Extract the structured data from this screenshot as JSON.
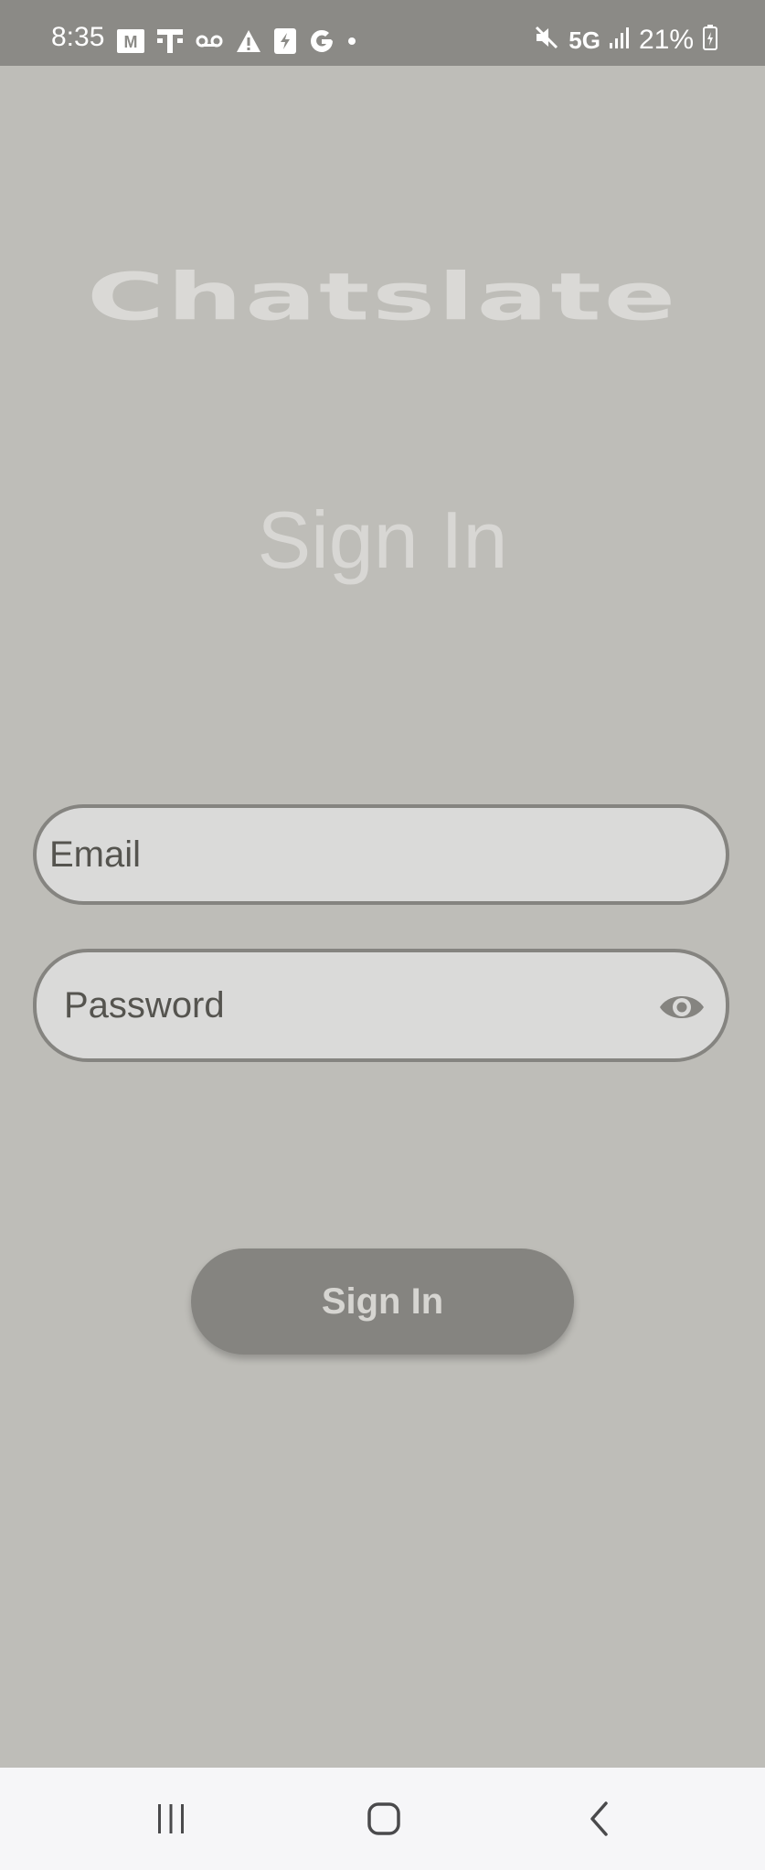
{
  "status_bar": {
    "time": "8:35",
    "left_icons": [
      "gmail-icon",
      "t-mobile-icon",
      "voicemail-icon",
      "warning-icon",
      "messages-icon",
      "google-icon",
      "notification-dot-icon"
    ],
    "right_icons": [
      "mute-icon",
      "signal-bars-icon",
      "battery-charging-icon"
    ],
    "network": "5G",
    "battery": "21%"
  },
  "app": {
    "logo": "Chatslate",
    "title": "Sign In"
  },
  "form": {
    "email_placeholder": "Email",
    "password_placeholder": "Password",
    "show_password_icon": "eye-icon",
    "submit_label": "Sign In"
  },
  "nav_bar": {
    "buttons": [
      "recents-icon",
      "home-icon",
      "back-icon"
    ]
  },
  "colors": {
    "background": "#bebdb8",
    "status_bar": "#8b8a86",
    "field_fill": "#dadad9",
    "field_border": "#858480",
    "button_fill": "#858480",
    "logo_text": "#dad9d6",
    "nav_bar": "#f6f6f8"
  }
}
